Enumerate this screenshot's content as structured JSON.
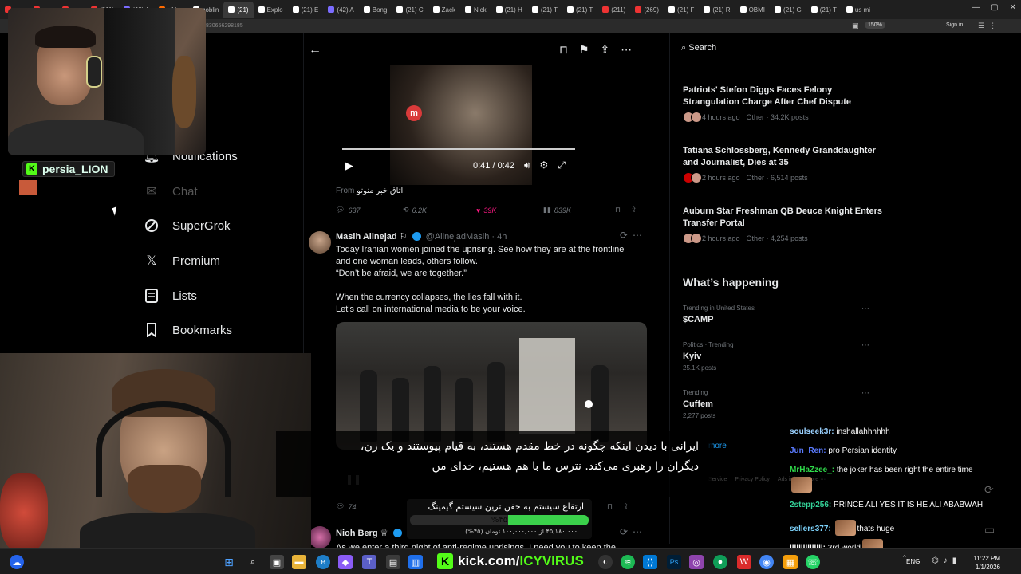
{
  "browser": {
    "tabs": [
      {
        "label": "",
        "icon": "red"
      },
      {
        "label": "",
        "icon": "red"
      },
      {
        "label": "",
        "icon": "red"
      },
      {
        "label": "(211)",
        "icon": "red"
      },
      {
        "label": "(42) A",
        "icon": "purple"
      },
      {
        "label": "r/Live",
        "icon": "orange"
      },
      {
        "label": "goblin",
        "icon": "white"
      },
      {
        "label": "(21)",
        "icon": "x",
        "active": true
      },
      {
        "label": "Explo",
        "icon": "x"
      },
      {
        "label": "(21) E",
        "icon": "x"
      },
      {
        "label": "(42) A",
        "icon": "purple"
      },
      {
        "label": "Bong",
        "icon": "white"
      },
      {
        "label": "(21) C",
        "icon": "x"
      },
      {
        "label": "Zack",
        "icon": "x"
      },
      {
        "label": "Nick",
        "icon": "x"
      },
      {
        "label": "(21) H",
        "icon": "x"
      },
      {
        "label": "(21) T",
        "icon": "x"
      },
      {
        "label": "(21) T",
        "icon": "x"
      },
      {
        "label": "(211)",
        "icon": "red"
      },
      {
        "label": "(269)",
        "icon": "red"
      },
      {
        "label": "(21) F",
        "icon": "x"
      },
      {
        "label": "(21) R",
        "icon": "x"
      },
      {
        "label": "OBMI",
        "icon": "x"
      },
      {
        "label": "(21) G",
        "icon": "x"
      },
      {
        "label": "(21) T",
        "icon": "x"
      },
      {
        "label": "us mi",
        "icon": "white"
      }
    ],
    "url_fragment": "830656298185",
    "zoom": "150%",
    "sign_in": "Sign in"
  },
  "nav": {
    "items": [
      {
        "label": "e",
        "icon": "home-icon"
      },
      {
        "label": "Notifications",
        "icon": "bell-icon"
      },
      {
        "label": "Chat",
        "icon": "mail-icon"
      },
      {
        "label": "SuperGrok",
        "icon": "grok-icon"
      },
      {
        "label": "Premium",
        "icon": "x-logo-icon"
      },
      {
        "label": "Lists",
        "icon": "list-icon"
      },
      {
        "label": "Bookmarks",
        "icon": "bookmark-icon"
      }
    ]
  },
  "tweet1": {
    "video_time": "0:41 / 0:42",
    "from_label": "From",
    "from_source": "اتاق خبر منوتو",
    "metrics": {
      "replies": "637",
      "reposts": "6.2K",
      "likes": "39K",
      "views": "839K"
    }
  },
  "tweet2": {
    "name": "Masih Alinejad",
    "handle": "@AlinejadMasih · 4h",
    "body_line1": "Today Iranian women joined the uprising. See how they are at the frontline",
    "body_line2": "and one woman leads, others follow.",
    "body_line3": "“Don’t be afraid, we are together.”",
    "body_line4": "When the  currency collapses, the lies fall with it.",
    "body_line5": "Let’s call on international media to be your voice.",
    "replies": "74"
  },
  "tweet3": {
    "name": "Nioh Berg",
    "body": "As we enter a third night of anti-regime uprisings, I need you to keep the"
  },
  "sidebar": {
    "search_placeholder": "Search",
    "news": [
      {
        "title": "Patriots' Stefon Diggs Faces Felony Strangulation Charge After Chef Dispute",
        "meta": "4 hours ago · Other · 34.2K posts"
      },
      {
        "title": "Tatiana Schlossberg, Kennedy Granddaughter and Journalist, Dies at 35",
        "meta": "2 hours ago · Other · 6,514 posts"
      },
      {
        "title": "Auburn Star Freshman QB Deuce Knight Enters Transfer Portal",
        "meta": "2 hours ago · Other · 4,254 posts"
      }
    ],
    "whats_happening": "What’s happening",
    "trends": [
      {
        "context": "Trending in United States",
        "name": "$CAMP",
        "count": ""
      },
      {
        "context": "Politics · Trending",
        "name": "Kyiv",
        "count": "25.1K posts"
      },
      {
        "context": "Trending",
        "name": "Cuffem",
        "count": "2,277 posts"
      }
    ],
    "show_more": "more",
    "footer_links": [
      "Service",
      "Privacy Policy",
      "Ads info",
      "More ···"
    ]
  },
  "stream": {
    "streamer_name": "persia_LION",
    "subtitle_line1": "ایرانی با دیدن اینکه چگونه در خط مقدم هستند، به قیام پیوستند و یک زن،",
    "subtitle_line2": "دیگران را رهبری می‌کند. نترس ما با هم هستیم، خدای من",
    "upgrade_title": "ارتقاع سیستم به خفن ترین سیستم گیمینگ",
    "upgrade_percent_label": "%۴۵",
    "upgrade_fraction": 0.45,
    "upgrade_amount": "۴۵,۱۸۰,۰۰۰ از ۱۰۰,۰۰۰,۰۰۰ تومان (۴۵%)",
    "kick_domain": "kick.com/",
    "kick_channel": "ICYVIRUS"
  },
  "chat": [
    {
      "user": "soulseek3r:",
      "color": "#9ad1ff",
      "msg": "inshallahhhhhh"
    },
    {
      "user": "Jun_Ren:",
      "color": "#5b7bff",
      "msg": "pro Persian identity"
    },
    {
      "user": "MrHaZzee_:",
      "color": "#2fd94a",
      "msg": "the joker has been right the entire time"
    },
    {
      "user": "2stepp256:",
      "color": "#34d399",
      "msg": "PRINCE ALI YES IT IS HE ALI ABABWAH"
    },
    {
      "user": "sellers377:",
      "color": "#7dd3fc",
      "msg": "thats huge"
    },
    {
      "user": "lllllllllllllll:",
      "color": "#ffffff",
      "msg": "3rd world"
    }
  ],
  "taskbar": {
    "lang": "ENG",
    "time": "11:22 PM",
    "date": "1/1/2026"
  }
}
